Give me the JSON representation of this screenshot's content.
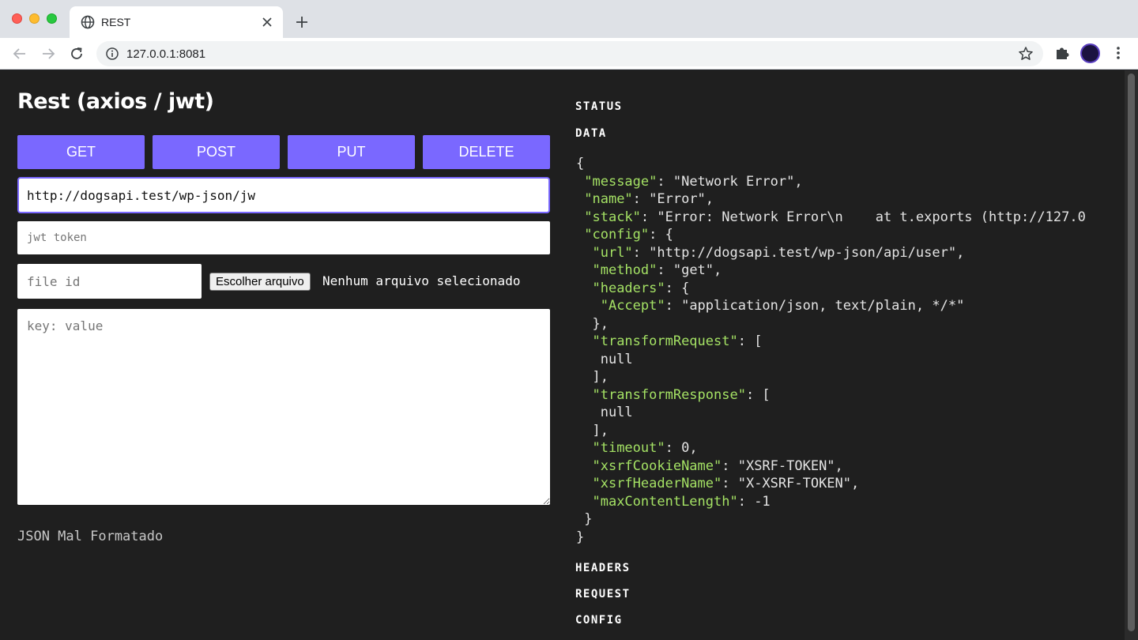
{
  "browser": {
    "tab_title": "REST",
    "url": "127.0.0.1:8081"
  },
  "app": {
    "title": "Rest (axios / jwt)",
    "methods": [
      "GET",
      "POST",
      "PUT",
      "DELETE"
    ],
    "url_value": "http://dogsapi.test/wp-json/jw",
    "jwt_placeholder": "jwt token",
    "file_id_placeholder": "file id",
    "choose_file_label": "Escolher arquivo",
    "no_file_text": "Nenhum arquivo selecionado",
    "body_placeholder": "key: value",
    "json_error": "JSON Mal Formatado"
  },
  "response": {
    "labels": {
      "status": "STATUS",
      "data": "DATA",
      "headers": "HEADERS",
      "request": "REQUEST",
      "config": "CONFIG"
    },
    "data_lines": [
      {
        "t": "{"
      },
      {
        "t": " ",
        "k": "\"message\"",
        "r": ": \"Network Error\","
      },
      {
        "t": " ",
        "k": "\"name\"",
        "r": ": \"Error\","
      },
      {
        "t": " ",
        "k": "\"stack\"",
        "r": ": \"Error: Network Error\\n    at t.exports (http://127.0"
      },
      {
        "t": " ",
        "k": "\"config\"",
        "r": ": {"
      },
      {
        "t": "  ",
        "k": "\"url\"",
        "r": ": \"http://dogsapi.test/wp-json/api/user\","
      },
      {
        "t": "  ",
        "k": "\"method\"",
        "r": ": \"get\","
      },
      {
        "t": "  ",
        "k": "\"headers\"",
        "r": ": {"
      },
      {
        "t": "   ",
        "k": "\"Accept\"",
        "r": ": \"application/json, text/plain, */*\""
      },
      {
        "t": "  },"
      },
      {
        "t": "  ",
        "k": "\"transformRequest\"",
        "r": ": ["
      },
      {
        "t": "   null"
      },
      {
        "t": "  ],"
      },
      {
        "t": "  ",
        "k": "\"transformResponse\"",
        "r": ": ["
      },
      {
        "t": "   null"
      },
      {
        "t": "  ],"
      },
      {
        "t": "  ",
        "k": "\"timeout\"",
        "r": ": 0,"
      },
      {
        "t": "  ",
        "k": "\"xsrfCookieName\"",
        "r": ": \"XSRF-TOKEN\","
      },
      {
        "t": "  ",
        "k": "\"xsrfHeaderName\"",
        "r": ": \"X-XSRF-TOKEN\","
      },
      {
        "t": "  ",
        "k": "\"maxContentLength\"",
        "r": ": -1"
      },
      {
        "t": " }"
      },
      {
        "t": "}"
      }
    ]
  },
  "colors": {
    "accent": "#7a68ff",
    "json_key": "#a4e164",
    "page_bg": "#1f1f1f"
  },
  "icons": {
    "tab_favicon": "globe-icon",
    "tab_close": "close-icon",
    "new_tab": "plus-icon",
    "back": "arrow-left-icon",
    "forward": "arrow-right-icon",
    "reload": "reload-icon",
    "site_info": "info-icon",
    "bookmark": "star-icon",
    "extensions": "puzzle-icon",
    "profile": "avatar",
    "menu": "kebab-menu-icon"
  }
}
